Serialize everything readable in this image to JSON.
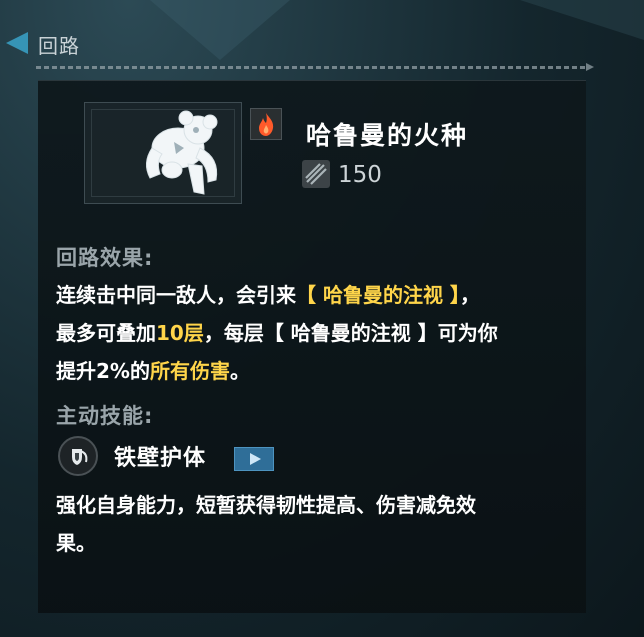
{
  "header": {
    "back_label": "回路"
  },
  "item": {
    "name": "哈鲁曼的火种",
    "element_icon": "fire-icon",
    "cost_icon": "slash-cost-icon",
    "cost": "150"
  },
  "circuit_effect": {
    "title": "回路效果:",
    "line1_a": "连续击中同一敌人，会引来",
    "line1_hl": "【 哈鲁曼的注视 】",
    "line1_b": "，",
    "line2_a": "最多可叠加",
    "line2_hl": "10层",
    "line2_b": "，每层【 哈鲁曼的注视 】可为你",
    "line3_a": "提升2%的",
    "line3_hl": "所有伤害",
    "line3_b": "。"
  },
  "active_skill": {
    "title": "主动技能:",
    "icon": "shield-swirl-icon",
    "name": "铁壁护体",
    "play_icon": "play-icon",
    "description_line1": "强化自身能力，短暂获得韧性提高、伤害减免效",
    "description_line2": "果。"
  },
  "colors": {
    "highlight": "#ffd54a",
    "fire": "#ff5a2a",
    "play_button": "#2f6e98"
  }
}
